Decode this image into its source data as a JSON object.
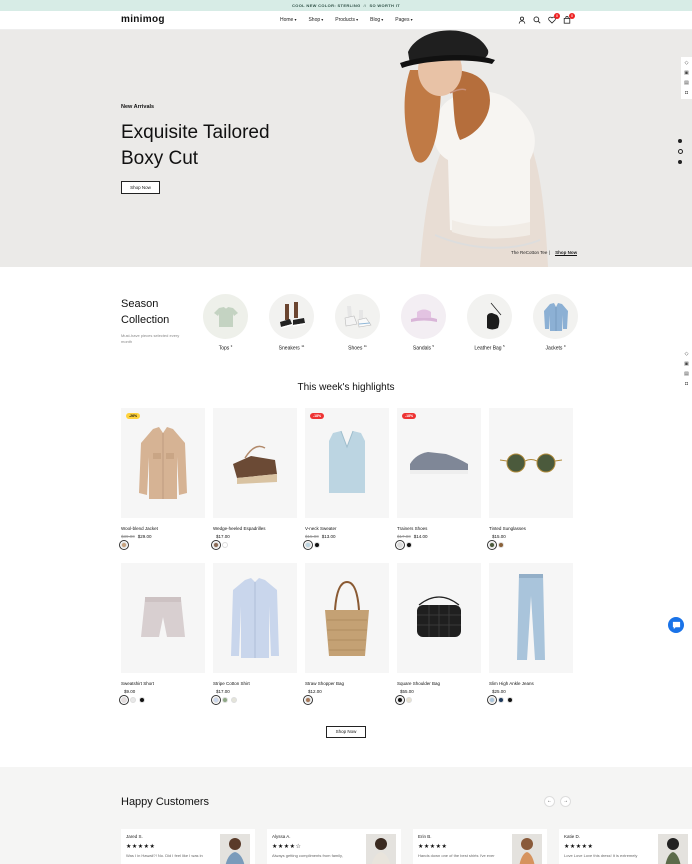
{
  "announcement": {
    "left": "COOL NEW COLOR: STERLING",
    "sep": "//",
    "right": "SO WORTH IT"
  },
  "header": {
    "logo": "minimog",
    "nav": [
      "Home",
      "Shop",
      "Products",
      "Blog",
      "Pages"
    ],
    "wishlist_count": "0",
    "cart_count": "0"
  },
  "hero": {
    "subtitle": "New Arrivals",
    "title_line1": "Exquisite Tailored",
    "title_line2": "Boxy Cut",
    "button": "Shop Now",
    "caption": "The ReCotton Tee",
    "caption_sep": "|",
    "caption_link": "Shop Now"
  },
  "season": {
    "title_line1": "Season",
    "title_line2": "Collection",
    "desc": "Must-have pieces selected every month",
    "categories": [
      {
        "label": "Tops",
        "count": "3"
      },
      {
        "label": "Sneakers",
        "count": "11"
      },
      {
        "label": "Shoes",
        "count": "11"
      },
      {
        "label": "Sandals",
        "count": "5"
      },
      {
        "label": "Leather Bag",
        "count": "5"
      },
      {
        "label": "Jackets",
        "count": "9"
      }
    ]
  },
  "highlights": {
    "title": "This week's highlights",
    "products": [
      {
        "name": "Wool-blend Jacket",
        "old": "$39.00",
        "price": "$29.00",
        "tag": "-26%",
        "tag_type": "hot"
      },
      {
        "name": "Wedge-heeled Espadrilles",
        "old": "",
        "price": "$17.00",
        "tag": "",
        "tag_type": ""
      },
      {
        "name": "V-neck Sweater",
        "old": "$15.00",
        "price": "$13.00",
        "tag": "-18%",
        "tag_type": "sale"
      },
      {
        "name": "Trainers Shoes",
        "old": "$17.00",
        "price": "$14.00",
        "tag": "-18%",
        "tag_type": "sale"
      },
      {
        "name": "Tinted Sunglasses",
        "old": "",
        "price": "$15.00",
        "tag": "",
        "tag_type": ""
      },
      {
        "name": "Sweatshirt Short",
        "old": "",
        "price": "$9.00",
        "tag": "",
        "tag_type": ""
      },
      {
        "name": "Stripe Cotton Shirt",
        "old": "",
        "price": "$17.00",
        "tag": "",
        "tag_type": ""
      },
      {
        "name": "Straw Shopper Bag",
        "old": "",
        "price": "$12.00",
        "tag": "",
        "tag_type": ""
      },
      {
        "name": "Square Shoulder Bag",
        "old": "",
        "price": "$55.00",
        "tag": "",
        "tag_type": ""
      },
      {
        "name": "Slim High Ankle Jeans",
        "old": "",
        "price": "$25.00",
        "tag": "",
        "tag_type": ""
      }
    ],
    "shop_now": "Shop Now"
  },
  "customers": {
    "title": "Happy Customers",
    "reviews": [
      {
        "name": "Jared S.",
        "stars": "★★★★★",
        "text": "Was I in Hawaii?! No. Did I feel like I was in"
      },
      {
        "name": "Alyssa A.",
        "stars": "★★★★☆",
        "text": "Always getting compliments from family,"
      },
      {
        "name": "Erin B.",
        "stars": "★★★★★",
        "text": "Hands down one of the best shirts I've ever"
      },
      {
        "name": "Katie D.",
        "stars": "★★★★★",
        "text": "Love Love Love this dress! It is extremely"
      }
    ]
  },
  "colors": {
    "accent": "#e22222",
    "topbar": "#d7ece6",
    "chat": "#1a73e8"
  }
}
